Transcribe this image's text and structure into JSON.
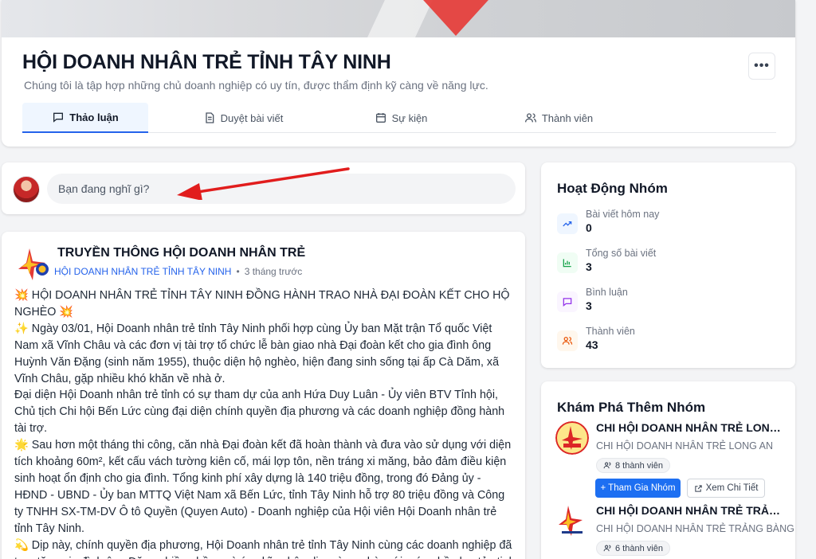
{
  "header": {
    "title": "HỘI DOANH NHÂN TRẺ TỈNH TÂY NINH",
    "description": "Chúng tôi là tập hợp những chủ doanh nghiệp có uy tín, được thẩm định kỹ càng về năng lực.",
    "more_label": "•••",
    "tabs": [
      {
        "label": "Thảo luận",
        "icon": "chat-icon",
        "active": true
      },
      {
        "label": "Duyệt bài viết",
        "icon": "document-icon",
        "active": false
      },
      {
        "label": "Sự kiện",
        "icon": "calendar-icon",
        "active": false
      },
      {
        "label": "Thành viên",
        "icon": "users-icon",
        "active": false
      }
    ]
  },
  "composer": {
    "placeholder": "Bạn đang nghĩ gì?"
  },
  "post": {
    "author": "TRUYỀN THÔNG HỘI DOANH NHÂN TRẺ",
    "group": "HỘI DOANH NHÂN TRẺ TỈNH TÂY NINH",
    "separator": "•",
    "time": "3 tháng trước",
    "paragraphs": [
      "💥 HỘI DOANH NHÂN TRẺ TỈNH TÂY NINH ĐỒNG HÀNH TRAO NHÀ ĐẠI ĐOÀN KẾT CHO HỘ NGHÈO 💥",
      "✨ Ngày 03/01, Hội Doanh nhân trẻ tỉnh Tây Ninh phối hợp cùng Ủy ban Mặt trận Tổ quốc Việt Nam xã Vĩnh Châu và các đơn vị tài trợ tổ chức lễ bàn giao nhà Đại đoàn kết cho gia đình ông Huỳnh Văn Đặng (sinh năm 1955), thuộc diện hộ nghèo, hiện đang sinh sống tại ấp Cà Dăm, xã Vĩnh Châu, gặp nhiều khó khăn về nhà ở.",
      "Đại diện Hội Doanh nhân trẻ tỉnh có sự tham dự của anh Hứa Duy Luân - Ủy viên BTV Tỉnh hội, Chủ tịch Chi hội Bến Lức cùng đại diện chính quyền địa phương và các doanh nghiệp đồng hành tài trợ.",
      "🌟 Sau hơn một tháng thi công, căn nhà Đại đoàn kết đã hoàn thành và đưa vào sử dụng với diện tích khoảng 60m², kết cấu vách tường kiên cố, mái lợp tôn, nền tráng xi măng, bảo đảm điều kiện sinh hoạt ổn định cho gia đình. Tổng kinh phí xây dựng là 140 triệu đồng, trong đó Đảng ủy - HĐND - UBND - Ủy ban MTTQ Việt Nam xã Bến Lức, tỉnh Tây Ninh hỗ trợ 80 triệu đồng và Công ty TNHH SX-TM-DV Ô tô Quyền (Quyen Auto) - Doanh nghiệp của Hội viên Hội Doanh nhân trẻ tỉnh Tây Ninh.",
      "💫 Dịp này, chính quyền địa phương, Hội Doanh nhân trẻ tỉnh Tây Ninh cùng các doanh nghiệp đã trao tặng gia đình ông Đặng nhiều phần quà ý nghĩa nhân dịp mừng nhà mới, góp phần lan tỏa tinh thần “Doanh nhân trẻ Tây Ninh - trách nhiệm với cộng đồng”."
    ]
  },
  "activity": {
    "title": "Hoạt Động Nhóm",
    "stats": [
      {
        "label": "Bài viết hôm nay",
        "value": "0",
        "icon": "trending-icon",
        "color": "#2563eb",
        "bg": "#eff6ff"
      },
      {
        "label": "Tổng số bài viết",
        "value": "3",
        "icon": "bar-chart-icon",
        "color": "#16a34a",
        "bg": "#f0fdf4"
      },
      {
        "label": "Bình luận",
        "value": "3",
        "icon": "comment-icon",
        "color": "#9333ea",
        "bg": "#faf5ff"
      },
      {
        "label": "Thành viên",
        "value": "43",
        "icon": "users-icon",
        "color": "#ea580c",
        "bg": "#fff7ed"
      }
    ]
  },
  "explore": {
    "title": "Khám Phá Thêm Nhóm",
    "groups": [
      {
        "name": "CHI HỘI DOANH NHÂN TRẺ LONG AN",
        "subtitle": "CHI HỘI DOANH NHÂN TRẺ LONG AN",
        "members": "8 thành viên",
        "join_label": "+ Tham Gia Nhóm",
        "detail_label": "Xem Chi Tiết"
      },
      {
        "name": "CHI HỘI DOANH NHÂN TRẺ TRẢNG BÀNG",
        "subtitle": "CHI HỘI DOANH NHÂN TRẺ TRẢNG BÀNG",
        "members": "6 thành viên"
      }
    ]
  },
  "colors": {
    "accent": "#2563eb",
    "join_button": "#1d6ff2",
    "annotation_arrow": "#e11d1d"
  }
}
